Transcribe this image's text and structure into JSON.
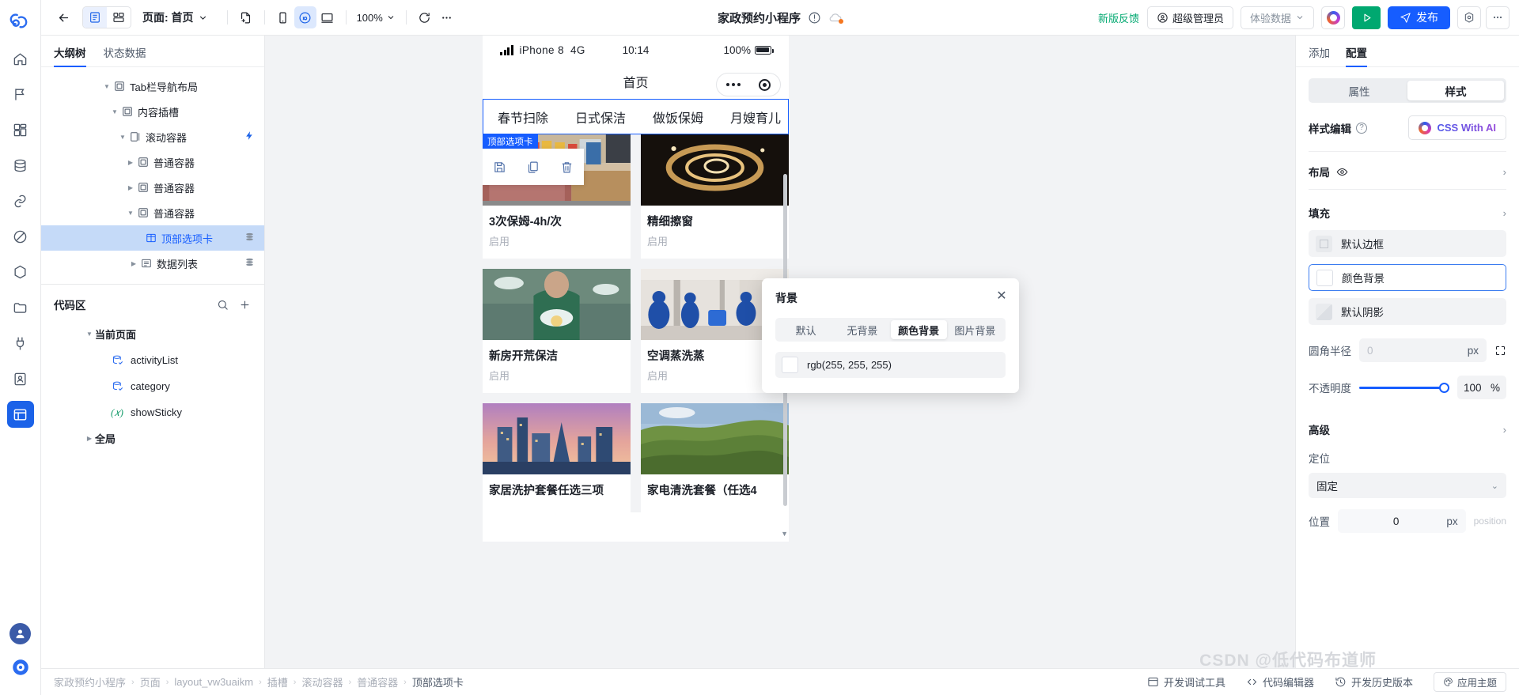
{
  "rail": {
    "logo_icon": "cloud-logo-icon",
    "items": [
      {
        "name": "home-icon"
      },
      {
        "name": "flag-icon"
      },
      {
        "name": "dashboard-icon"
      },
      {
        "name": "database-icon"
      },
      {
        "name": "link-icon"
      },
      {
        "name": "shield-icon"
      },
      {
        "name": "cube-icon"
      },
      {
        "name": "folder-icon"
      },
      {
        "name": "plug-icon"
      },
      {
        "name": "contacts-icon"
      },
      {
        "name": "layout-icon"
      }
    ],
    "avatar_icon": "user-avatar-icon",
    "help_icon": "help-circle-icon"
  },
  "toolbar": {
    "back_icon": "back-arrow-icon",
    "view_outline_icon": "outline-view-icon",
    "view_grid_icon": "grid-view-icon",
    "page_label": "页面: 首页",
    "new_page_icon": "new-page-icon",
    "device_mobile_icon": "mobile-device-icon",
    "device_mini_icon": "miniprogram-icon",
    "device_desktop_icon": "desktop-device-icon",
    "zoom_value": "100%",
    "refresh_icon": "refresh-icon",
    "more_icon": "more-horizontal-icon",
    "app_title": "家政预约小程序",
    "warn_icon": "warning-circle-icon",
    "cloud_icon": "cloud-status-icon",
    "feedback_label": "新版反馈",
    "role_label": "超级管理员",
    "role_icon": "user-circle-icon",
    "env_label": "体验数据",
    "ai_icon": "ai-assistant-icon",
    "preview_icon": "play-icon",
    "publish_label": "发布",
    "publish_icon": "send-icon",
    "settings_icon": "settings-hex-icon",
    "overflow_icon": "more-horizontal-icon"
  },
  "left_panel": {
    "tabs": [
      {
        "label": "大纲树",
        "active": true
      },
      {
        "label": "状态数据",
        "active": false
      }
    ],
    "tree": [
      {
        "label": "Tab栏导航布局",
        "depth": 0,
        "caret": "down",
        "icon": "container-icon",
        "selected": false,
        "badge": false,
        "bolt": false
      },
      {
        "label": "内容插槽",
        "depth": 1,
        "caret": "down",
        "icon": "container-icon",
        "selected": false,
        "badge": false,
        "bolt": false
      },
      {
        "label": "滚动容器",
        "depth": 2,
        "caret": "down",
        "icon": "scroll-container-icon",
        "selected": false,
        "badge": false,
        "bolt": true
      },
      {
        "label": "普通容器",
        "depth": 3,
        "caret": "right",
        "icon": "container-icon",
        "selected": false,
        "badge": false,
        "bolt": false
      },
      {
        "label": "普通容器",
        "depth": 3,
        "caret": "right",
        "icon": "container-icon",
        "selected": false,
        "badge": false,
        "bolt": false
      },
      {
        "label": "普通容器",
        "depth": 3,
        "caret": "down",
        "icon": "container-icon",
        "selected": false,
        "badge": false,
        "bolt": false
      },
      {
        "label": "顶部选项卡",
        "depth": 4,
        "caret": "none",
        "icon": "tabs-icon",
        "selected": true,
        "badge": true,
        "bolt": false
      },
      {
        "label": "数据列表",
        "depth": 4,
        "caret": "right",
        "icon": "list-icon",
        "selected": false,
        "badge": true,
        "bolt": false
      }
    ],
    "code_area": {
      "title": "代码区",
      "search_icon": "search-icon",
      "add_icon": "plus-icon",
      "groups": [
        {
          "label": "当前页面",
          "caret": "down"
        }
      ],
      "items": [
        {
          "label": "activityList",
          "icon": "datasource-icon",
          "kind": "data"
        },
        {
          "label": "category",
          "icon": "datasource-icon",
          "kind": "data"
        },
        {
          "label": "showSticky",
          "icon": "variable-icon",
          "kind": "var"
        }
      ],
      "footer_group": {
        "label": "全局",
        "caret": "right"
      }
    }
  },
  "canvas": {
    "phone": {
      "status_bar": {
        "signal_icon": "signal-bars-icon",
        "device": "iPhone 8",
        "network": "4G",
        "time": "10:14",
        "battery_text": "100%",
        "battery_icon": "battery-full-icon"
      },
      "nav_title": "首页",
      "capsule": {
        "dots_icon": "more-dots-icon",
        "target_icon": "target-circle-icon"
      },
      "tabs": [
        "春节扫除",
        "日式保洁",
        "做饭保姆",
        "月嫂育儿"
      ],
      "selection": {
        "badge_label": "顶部选项卡",
        "actions": [
          {
            "name": "save-icon"
          },
          {
            "name": "copy-icon"
          },
          {
            "name": "delete-icon"
          }
        ]
      },
      "cards": [
        {
          "title": "3次保姆-4h/次",
          "status": "启用",
          "img": "supermarket"
        },
        {
          "title": "精细擦窗",
          "status": "启用",
          "img": "dark-swirl"
        },
        {
          "title": "新房开荒保洁",
          "status": "启用",
          "img": "tshirt-man"
        },
        {
          "title": "空调蒸洗蒸",
          "status": "启用",
          "img": "cleaners"
        },
        {
          "title": "家居洗护套餐任选三项",
          "status": "",
          "img": "city-night"
        },
        {
          "title": "家电清洗套餐（任选4",
          "status": "",
          "img": "green-hills"
        }
      ]
    }
  },
  "popover": {
    "title": "背景",
    "close_icon": "close-icon",
    "modes": [
      {
        "label": "默认",
        "active": false
      },
      {
        "label": "无背景",
        "active": false
      },
      {
        "label": "颜色背景",
        "active": true
      },
      {
        "label": "图片背景",
        "active": false
      }
    ],
    "color_value": "rgb(255, 255, 255)",
    "color_hex": "#ffffff"
  },
  "right_panel": {
    "tabs": [
      {
        "label": "添加",
        "active": false
      },
      {
        "label": "配置",
        "active": true
      }
    ],
    "seg": [
      {
        "label": "属性",
        "active": false
      },
      {
        "label": "样式",
        "active": true
      }
    ],
    "style_edit_label": "样式编辑",
    "help_icon": "question-circle-icon",
    "css_ai_label": "CSS With AI",
    "css_ai_icon": "ai-sparkle-icon",
    "sections": {
      "layout": {
        "label": "布局",
        "eye_icon": "eye-icon",
        "chevron": "chevron-right-icon"
      },
      "fill": {
        "label": "填充",
        "chevron": "chevron-right-icon"
      },
      "advanced": {
        "label": "高级",
        "chevron": "chevron-right-icon"
      }
    },
    "fill_items": [
      {
        "label": "默认边框",
        "type": "border",
        "active": false
      },
      {
        "label": "颜色背景",
        "type": "white",
        "active": true
      },
      {
        "label": "默认阴影",
        "type": "shadow",
        "active": false
      }
    ],
    "radius": {
      "label": "圆角半径",
      "value": "0",
      "unit": "px",
      "expand_icon": "expand-corners-icon"
    },
    "opacity": {
      "label": "不透明度",
      "value": "100",
      "unit": "%",
      "percent": 100
    },
    "position": {
      "label": "定位",
      "value": "固定",
      "chevron": "chevron-down-icon"
    },
    "location": {
      "label": "位置",
      "value": "0",
      "unit": "px",
      "ghost": "position"
    }
  },
  "bottom_bar": {
    "breadcrumb": [
      "家政预约小程序",
      "页面",
      "layout_vw3uaikm",
      "插槽",
      "滚动容器",
      "普通容器",
      "顶部选项卡"
    ],
    "devtools_label": "开发调试工具",
    "devtools_icon": "devtools-icon",
    "code_editor_label": "代码编辑器",
    "code_editor_icon": "code-brackets-icon",
    "history_label": "开发历史版本",
    "history_icon": "history-icon",
    "theme_label": "应用主题",
    "theme_icon": "palette-icon"
  },
  "watermark": "CSDN @低代码布道师"
}
